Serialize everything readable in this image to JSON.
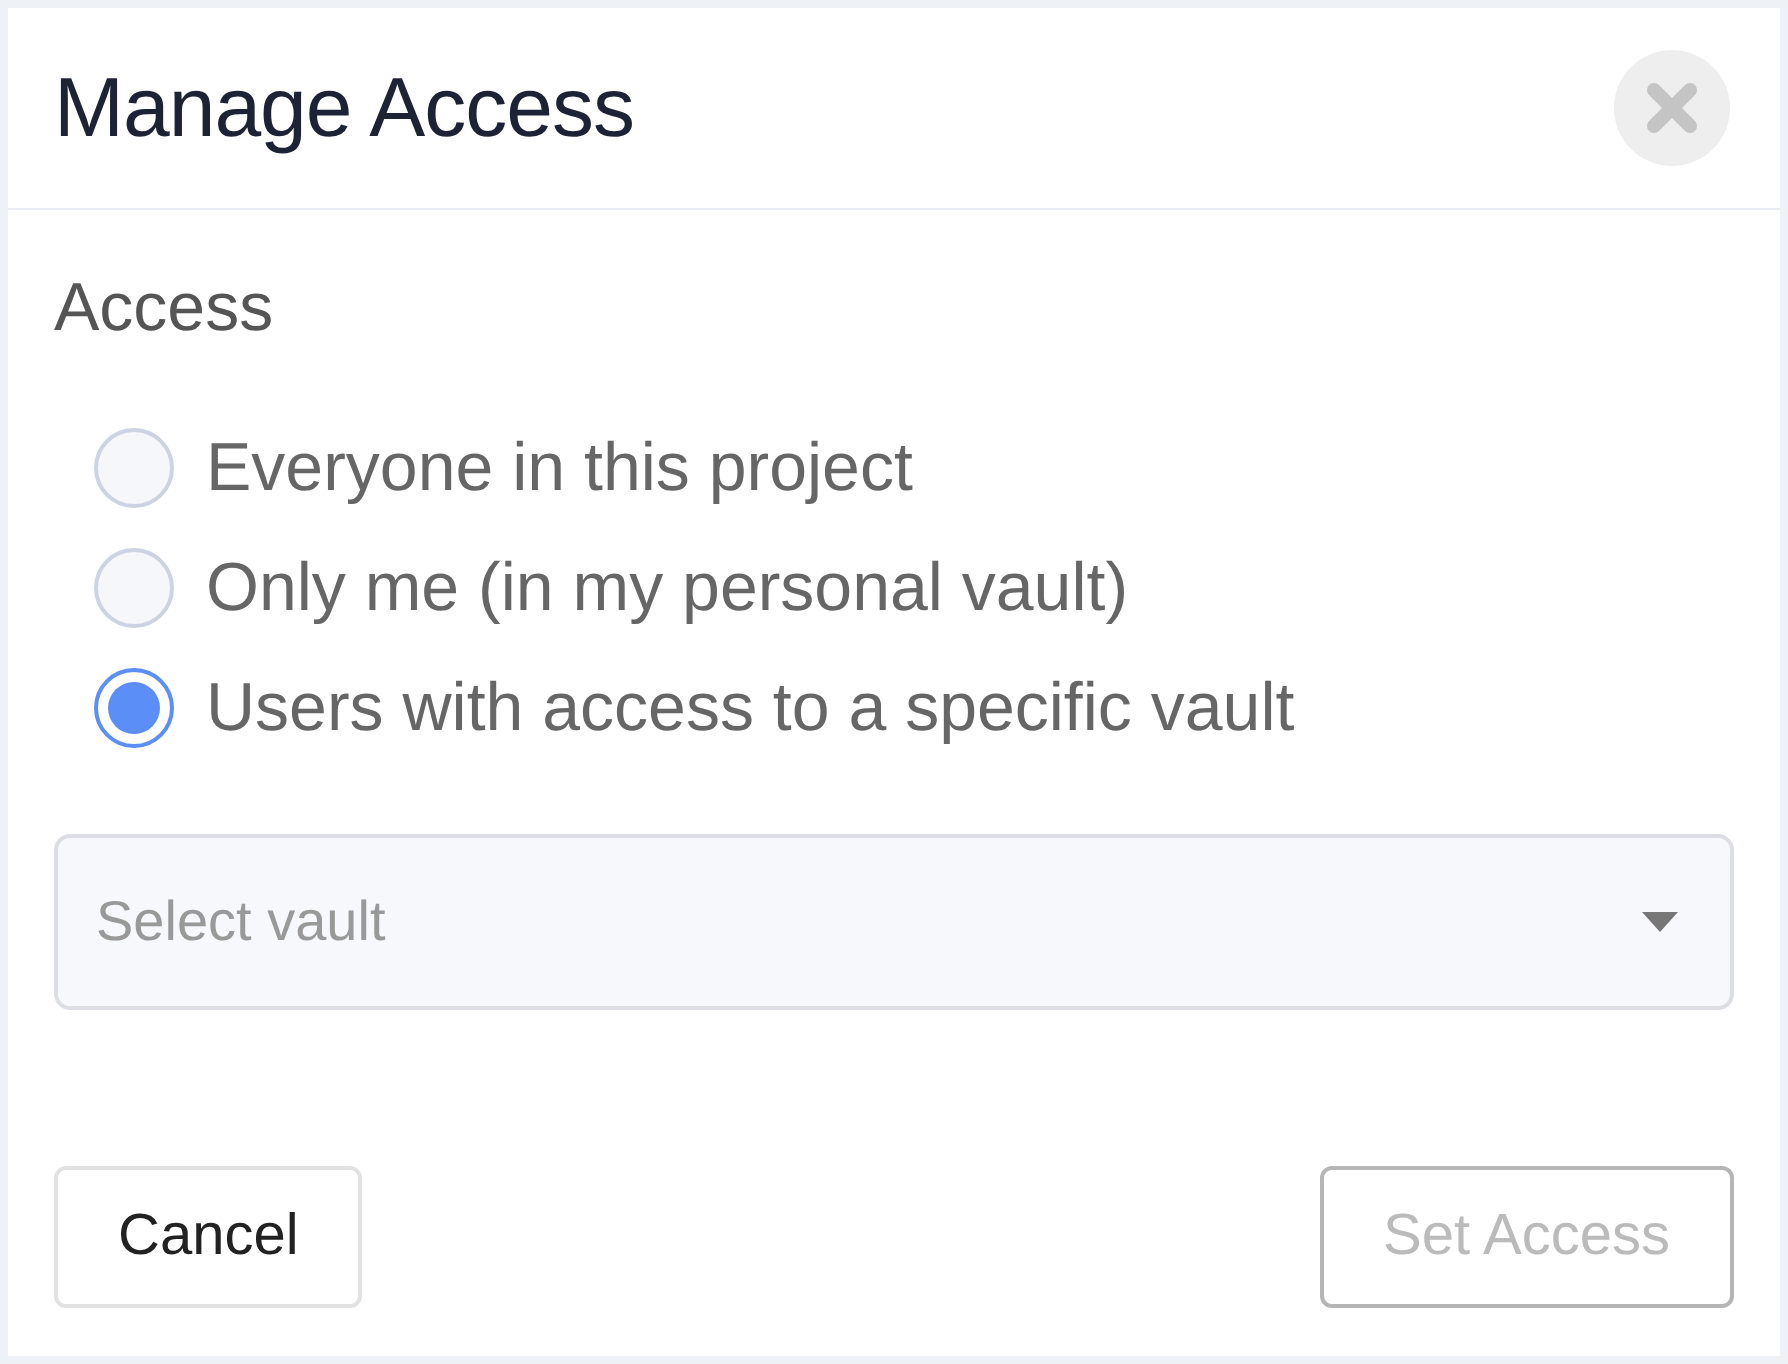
{
  "dialog": {
    "title": "Manage Access"
  },
  "access": {
    "label": "Access",
    "options": [
      {
        "label": "Everyone in this project",
        "selected": false
      },
      {
        "label": "Only me (in my personal vault)",
        "selected": false
      },
      {
        "label": "Users with access to a specific vault",
        "selected": true
      }
    ]
  },
  "vault_select": {
    "placeholder": "Select vault"
  },
  "buttons": [
    {
      "label": "Cancel",
      "disabled": false
    },
    {
      "label": "Set Access",
      "disabled": true
    }
  ]
}
